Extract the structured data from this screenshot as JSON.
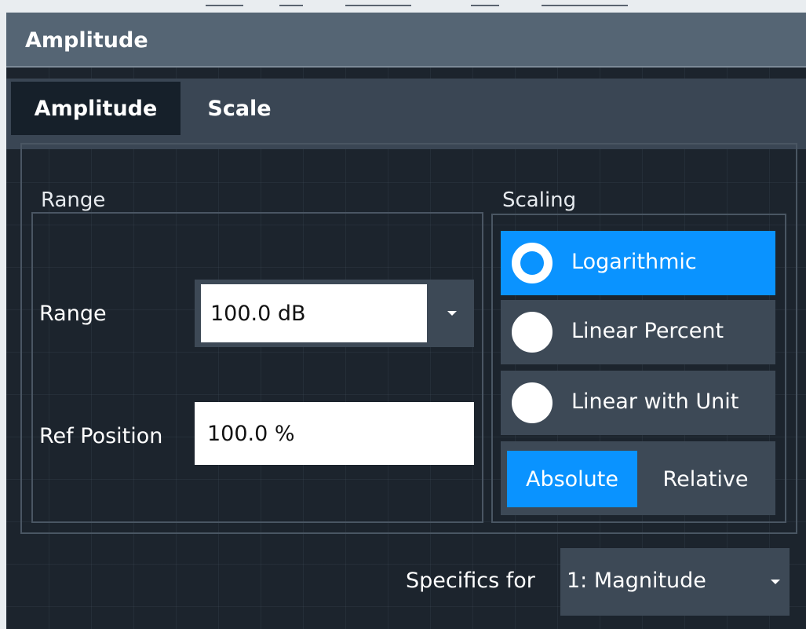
{
  "dialog": {
    "title": "Amplitude"
  },
  "tabs": [
    {
      "label": "Amplitude",
      "active": false
    },
    {
      "label": "Scale",
      "active": true
    }
  ],
  "range_group": {
    "title": "Range",
    "range_label": "Range",
    "range_value": "100.0 dB",
    "ref_position_label": "Ref Position",
    "ref_position_value": "100.0 %"
  },
  "scaling_group": {
    "title": "Scaling",
    "options": [
      {
        "label": "Logarithmic",
        "selected": true
      },
      {
        "label": "Linear Percent",
        "selected": false
      },
      {
        "label": "Linear with Unit",
        "selected": false
      }
    ],
    "mode_options": [
      {
        "label": "Absolute",
        "selected": true
      },
      {
        "label": "Relative",
        "selected": false
      }
    ]
  },
  "specifics": {
    "label": "Specifics for",
    "value": "1: Magnitude"
  },
  "colors": {
    "accent": "#0a93ff",
    "background": "#1c242d",
    "control": "#3d4956",
    "titlebar": "#556574"
  },
  "icons": [
    "chevron-down-icon",
    "radio-selected-icon",
    "radio-unselected-icon"
  ]
}
